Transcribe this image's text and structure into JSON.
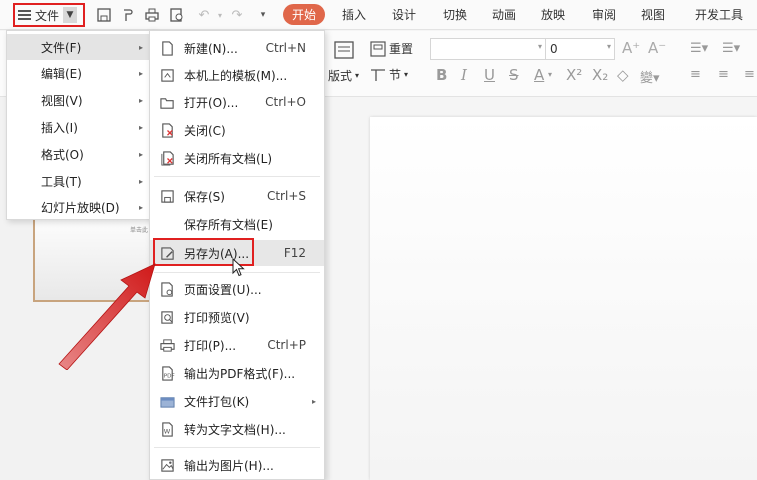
{
  "toolbar": {
    "file_menu_label": "文件",
    "tabs": [
      "开始",
      "插入",
      "设计",
      "切换",
      "动画",
      "放映",
      "审阅",
      "视图",
      "开发工具"
    ]
  },
  "ribbon": {
    "layout_label": "版式",
    "section_label": "节",
    "reset_label": "重置",
    "font_size_value": "0"
  },
  "menu_main": {
    "items": [
      {
        "label": "文件(F)",
        "active": true
      },
      {
        "label": "编辑(E)"
      },
      {
        "label": "视图(V)"
      },
      {
        "label": "插入(I)"
      },
      {
        "label": "格式(O)"
      },
      {
        "label": "工具(T)"
      },
      {
        "label": "幻灯片放映(D)"
      }
    ]
  },
  "menu_file": {
    "items": [
      {
        "label": "新建(N)...",
        "shortcut": "Ctrl+N",
        "icon": "new-doc-icon"
      },
      {
        "label": "本机上的模板(M)...",
        "shortcut": "",
        "icon": "template-icon"
      },
      {
        "label": "打开(O)...",
        "shortcut": "Ctrl+O",
        "icon": "folder-open-icon"
      },
      {
        "label": "关闭(C)",
        "shortcut": "",
        "icon": "close-doc-icon"
      },
      {
        "label": "关闭所有文档(L)",
        "shortcut": "",
        "icon": "close-all-icon"
      },
      {
        "label": "保存(S)",
        "shortcut": "Ctrl+S",
        "icon": "save-icon"
      },
      {
        "label": "保存所有文档(E)",
        "shortcut": "",
        "icon": ""
      },
      {
        "label": "另存为(A)...",
        "shortcut": "F12",
        "icon": "save-as-icon"
      },
      {
        "label": "页面设置(U)...",
        "shortcut": "",
        "icon": "page-setup-icon"
      },
      {
        "label": "打印预览(V)",
        "shortcut": "",
        "icon": "print-preview-icon"
      },
      {
        "label": "打印(P)...",
        "shortcut": "Ctrl+P",
        "icon": "print-icon"
      },
      {
        "label": "输出为PDF格式(F)...",
        "shortcut": "",
        "icon": "pdf-export-icon"
      },
      {
        "label": "文件打包(K)",
        "shortcut": "",
        "icon": "package-icon"
      },
      {
        "label": "转为文字文档(H)...",
        "shortcut": "",
        "icon": "convert-text-icon"
      },
      {
        "label": "输出为图片(H)...",
        "shortcut": "",
        "icon": "image-export-icon"
      }
    ]
  },
  "thumbnail": {
    "caption": "单击此"
  },
  "colors": {
    "accent": "#e0674a",
    "highlight_box": "#e02020"
  }
}
